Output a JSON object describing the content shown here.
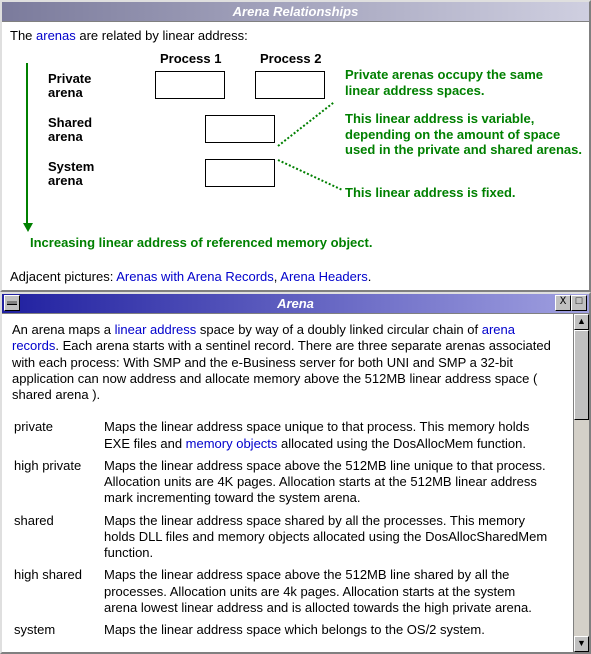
{
  "window1": {
    "title": "Arena Relationships",
    "intro_prefix": "The ",
    "intro_link": "arenas",
    "intro_suffix": " are related by linear address:"
  },
  "diagram": {
    "col1": "Process 1",
    "col2": "Process 2",
    "row1a": "Private",
    "row1b": "arena",
    "row2a": "Shared",
    "row2b": "arena",
    "row3a": "System",
    "row3b": "arena",
    "ann1": "Private arenas occupy the same linear address spaces.",
    "ann2": "This linear address is variable, depending on the amount of space used in the private and shared arenas.",
    "ann3": "This linear address is fixed.",
    "ann4": "Increasing linear address of referenced memory object."
  },
  "adjacent": {
    "prefix": "Adjacent pictures: ",
    "link1": "Arenas with Arena Records",
    "sep": ", ",
    "link2": "Arena Headers",
    "end": "."
  },
  "window2": {
    "title": "Arena",
    "p1a": "An arena maps a ",
    "link_la": "linear address",
    "p1b": " space by way of a doubly linked circular chain of ",
    "link_ar": "arena records",
    "p1c": ". Each arena starts with a sentinel record. There are three separate arenas associated with each process: With SMP and the e-Business server for both UNI and SMP a 32-bit application can now address and allocate memory above the 512MB linear address space ( shared arena ).",
    "defs": [
      {
        "term": "private",
        "prefix": "Maps the linear address space unique to that process. This memory holds EXE files and ",
        "link": "memory objects",
        "suffix": " allocated using the DosAllocMem function."
      },
      {
        "term": "high private",
        "text": "Maps the linear address space above the 512MB line unique to that process. Allocation units are 4K pages. Allocation starts at the 512MB linear address mark incrementing toward the system arena."
      },
      {
        "term": "shared",
        "text": "Maps the linear address space shared by all the processes. This memory holds DLL files and memory objects allocated using the DosAllocSharedMem function."
      },
      {
        "term": "high shared",
        "text": "Maps the linear address space above the 512MB line shared by all the processes.  Allocation units are 4k pages. Allocation starts at the system arena lowest linear address and is allocted towards the high private arena."
      },
      {
        "term": "system",
        "text": "Maps the linear address space which belongs to the OS/2 system."
      }
    ]
  },
  "buttons": {
    "close": "X",
    "max": "□",
    "up": "▲",
    "down": "▼"
  }
}
